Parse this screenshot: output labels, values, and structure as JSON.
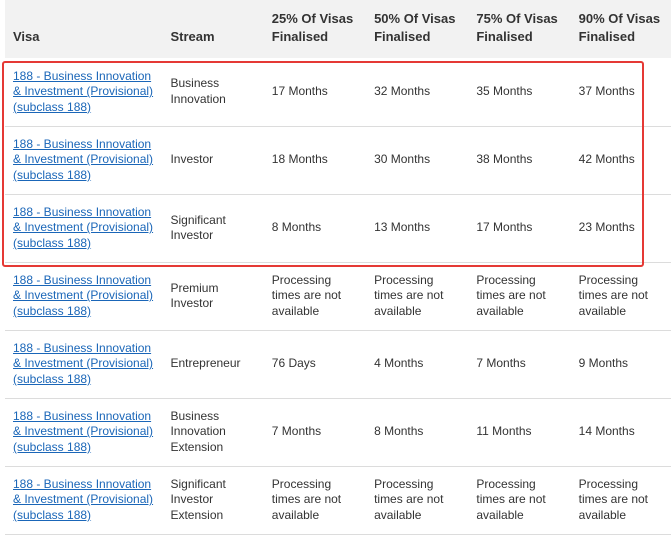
{
  "table": {
    "headers": {
      "visa": "Visa",
      "stream": "Stream",
      "p25": "25% Of Visas Finalised",
      "p50": "50% Of Visas Finalised",
      "p75": "75% Of Visas Finalised",
      "p90": "90% Of Visas Finalised"
    },
    "rows": [
      {
        "visa": "188 - Business Innovation & Investment (Provisional) (subclass 188)",
        "stream": "Business Innovation",
        "p25": "17 Months",
        "p50": "32 Months",
        "p75": "35 Months",
        "p90": "37 Months"
      },
      {
        "visa": "188 - Business Innovation & Investment (Provisional) (subclass 188)",
        "stream": "Investor",
        "p25": "18 Months",
        "p50": "30 Months",
        "p75": "38 Months",
        "p90": "42 Months"
      },
      {
        "visa": "188 - Business Innovation & Investment (Provisional) (subclass 188)",
        "stream": "Significant Investor",
        "p25": "8 Months",
        "p50": "13 Months",
        "p75": "17 Months",
        "p90": "23 Months"
      },
      {
        "visa": "188 - Business Innovation & Investment (Provisional) (subclass 188)",
        "stream": "Premium Investor",
        "p25": "Processing times are not available",
        "p50": "Processing times are not available",
        "p75": "Processing times are not available",
        "p90": "Processing times are not available"
      },
      {
        "visa": "188 - Business Innovation & Investment (Provisional) (subclass 188)",
        "stream": "Entrepreneur",
        "p25": "76 Days",
        "p50": "4 Months",
        "p75": "7 Months",
        "p90": "9 Months"
      },
      {
        "visa": "188 - Business Innovation & Investment (Provisional) (subclass 188)",
        "stream": "Business Innovation Extension",
        "p25": "7 Months",
        "p50": "8 Months",
        "p75": "11 Months",
        "p90": "14 Months"
      },
      {
        "visa": "188 - Business Innovation & Investment (Provisional) (subclass 188)",
        "stream": "Significant Investor Extension",
        "p25": "Processing times are not available",
        "p50": "Processing times are not available",
        "p75": "Processing times are not available",
        "p90": "Processing times are not available"
      }
    ]
  },
  "colors": {
    "link": "#1a66b8",
    "header_bg": "#f2f2f2",
    "highlight_border": "#e53935"
  }
}
